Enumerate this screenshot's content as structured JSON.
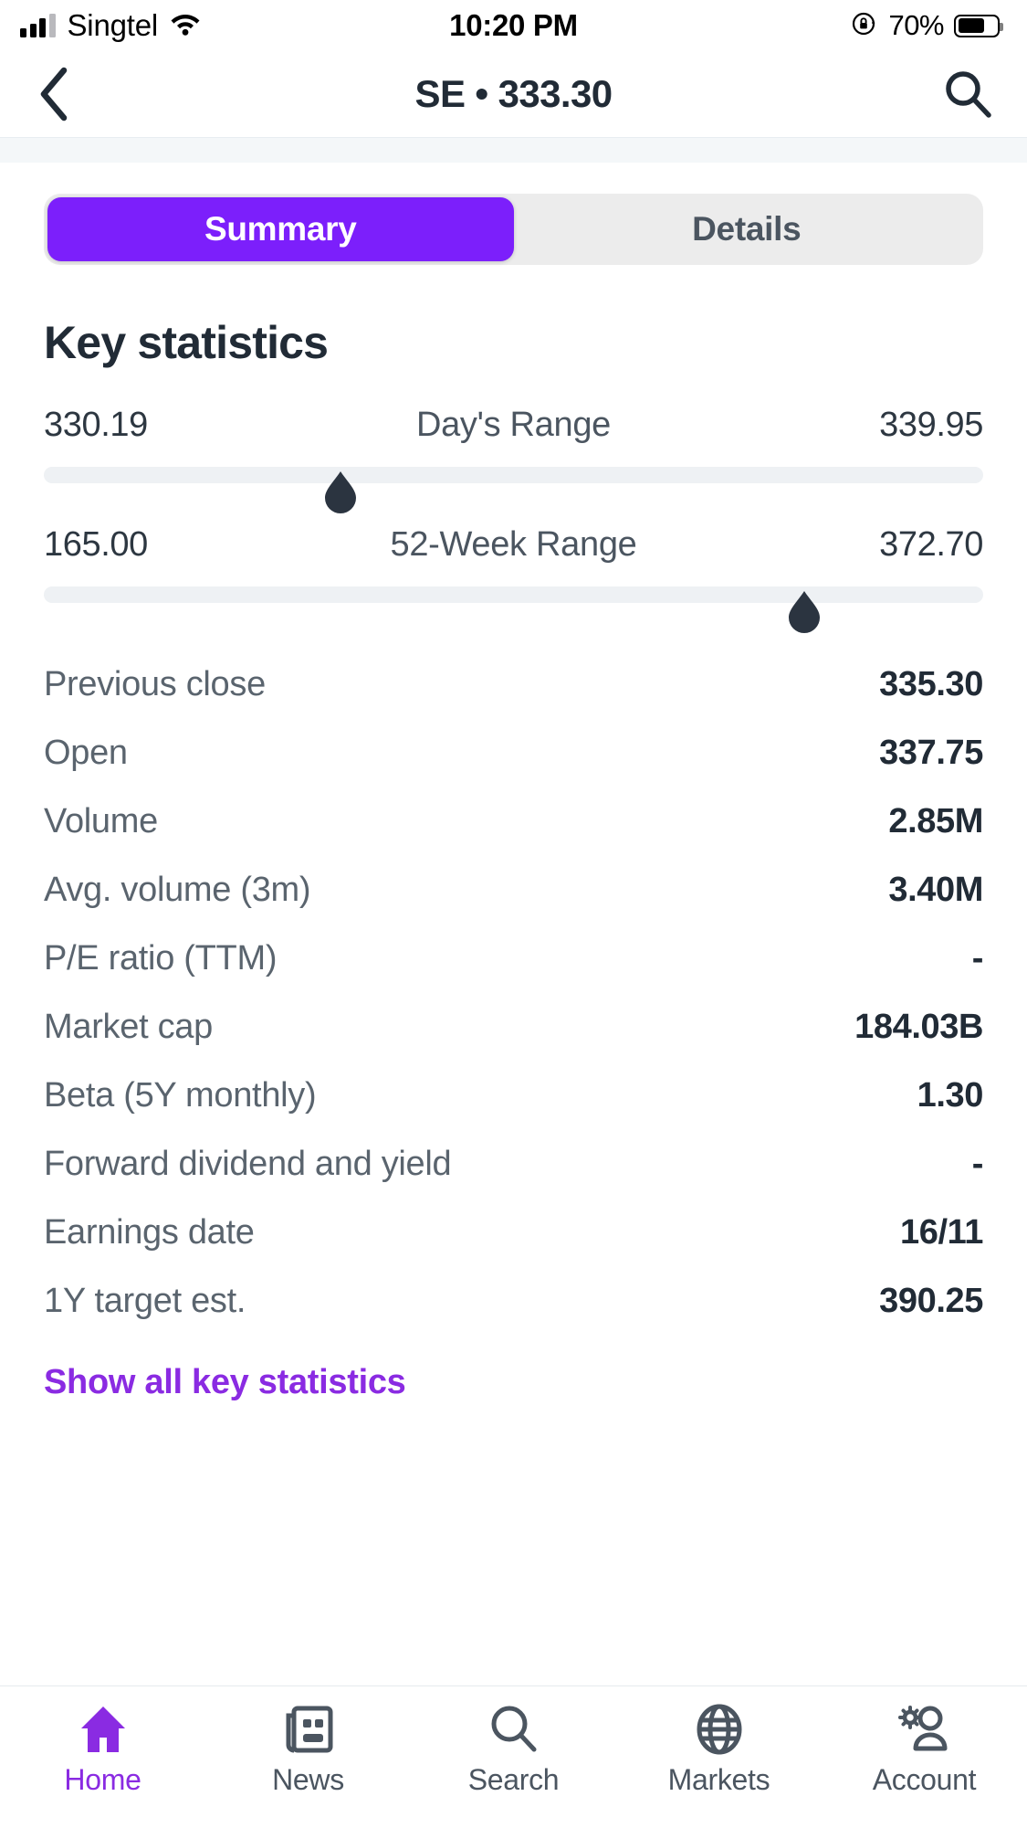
{
  "status_bar": {
    "carrier": "Singtel",
    "time": "10:20 PM",
    "battery_percent": "70%",
    "signal_icon": "cellular-signal-icon",
    "wifi_icon": "wifi-icon",
    "rotation_lock_icon": "rotation-lock-icon",
    "battery_icon": "battery-icon"
  },
  "nav_bar": {
    "back_icon": "back-chevron-icon",
    "title": "SE • 333.30",
    "search_icon": "search-icon"
  },
  "tabs": {
    "items": [
      {
        "label": "Summary",
        "active": true
      },
      {
        "label": "Details",
        "active": false
      }
    ]
  },
  "section": {
    "title": "Key statistics"
  },
  "ranges": [
    {
      "name": "days-range",
      "label": "Day's Range",
      "low": "330.19",
      "high": "339.95",
      "marker_percent": 31.6
    },
    {
      "name": "52-week-range",
      "label": "52-Week Range",
      "low": "165.00",
      "high": "372.70",
      "marker_percent": 81.0
    }
  ],
  "statistics": [
    {
      "label": "Previous close",
      "value": "335.30"
    },
    {
      "label": "Open",
      "value": "337.75"
    },
    {
      "label": "Volume",
      "value": "2.85M"
    },
    {
      "label": "Avg. volume (3m)",
      "value": "3.40M"
    },
    {
      "label": "P/E ratio (TTM)",
      "value": "-"
    },
    {
      "label": "Market cap",
      "value": "184.03B"
    },
    {
      "label": "Beta (5Y monthly)",
      "value": "1.30"
    },
    {
      "label": "Forward dividend and yield",
      "value": "-"
    },
    {
      "label": "Earnings date",
      "value": "16/11"
    },
    {
      "label": "1Y target est.",
      "value": "390.25"
    }
  ],
  "show_all_link": "Show all key statistics",
  "tab_bar": {
    "items": [
      {
        "label": "Home",
        "icon": "home-icon",
        "active": true
      },
      {
        "label": "News",
        "icon": "news-icon",
        "active": false
      },
      {
        "label": "Search",
        "icon": "search-icon",
        "active": false
      },
      {
        "label": "Markets",
        "icon": "globe-icon",
        "active": false
      },
      {
        "label": "Account",
        "icon": "account-gear-person-icon",
        "active": false
      }
    ]
  },
  "colors": {
    "accent_purple": "#7C1FFB",
    "link_purple": "#8a2be2",
    "text_dark": "#212b36",
    "text_muted": "#5a646e",
    "track_gray": "#eef1f4",
    "segment_bg": "#ececec"
  }
}
